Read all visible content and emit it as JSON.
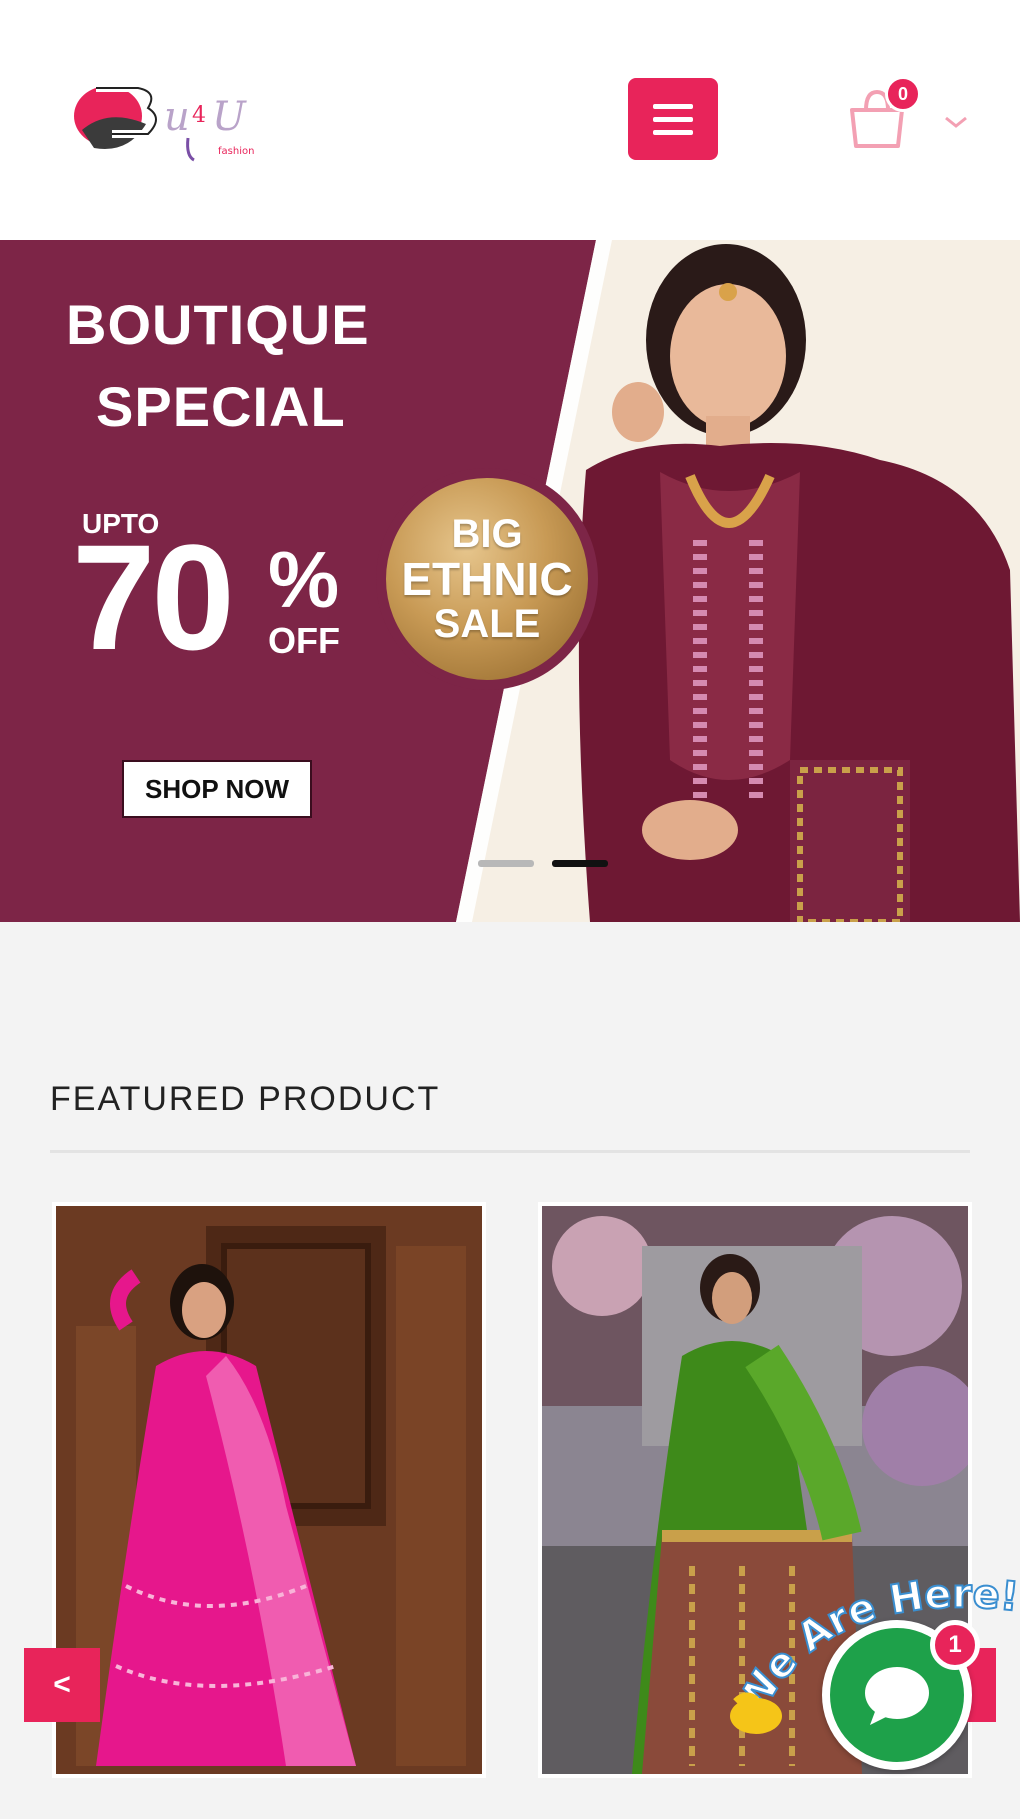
{
  "header": {
    "logo_icon": "brand-logo",
    "menu_icon": "hamburger-icon",
    "cart_icon": "shopping-bag-icon",
    "cart_count": "0",
    "chevron_icon": "chevron-down-icon"
  },
  "banner": {
    "line1": "BOUTIQUE",
    "line2": "SPECIAL",
    "upto": "UPTO",
    "percent": "70",
    "percent_sign": "%",
    "off": "OFF",
    "badge_line1": "BIG",
    "badge_line2": "ETHNIC",
    "badge_line3": "SALE",
    "cta": "SHOP NOW",
    "slides": 2,
    "active_slide": 2
  },
  "featured": {
    "title": "FEATURED PRODUCT",
    "prev_label": "<",
    "products": [
      {
        "image_icon": "pink-saree-photo"
      },
      {
        "image_icon": "green-saree-photo"
      }
    ]
  },
  "chat": {
    "banner_text": "We Are Here!",
    "unread": "1",
    "icon": "chat-bubble-icon"
  },
  "colors": {
    "accent": "#e8245a",
    "banner_maroon": "#7d2547",
    "gold": "#c89a55",
    "chat_green": "#1ea14a",
    "page_bg": "#f3f3f3"
  }
}
